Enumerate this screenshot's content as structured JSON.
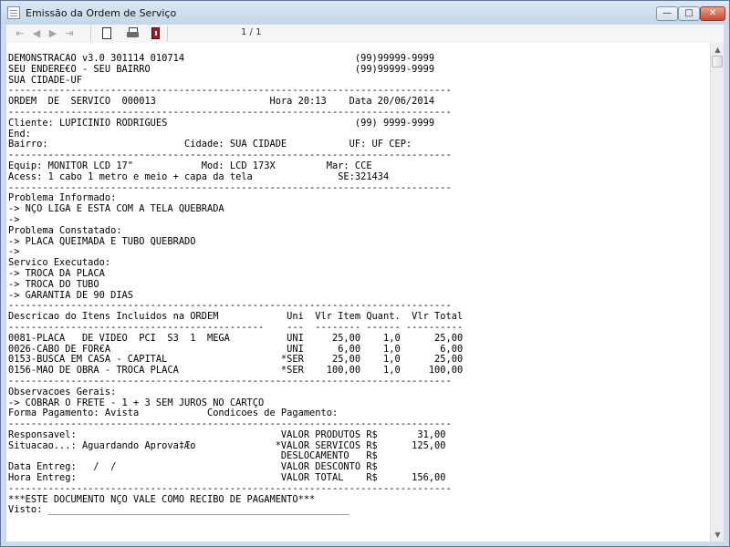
{
  "window": {
    "title": "Emissão da Ordem de Serviço",
    "controls": {
      "minimize": "—",
      "maximize": "□",
      "close": "✕"
    }
  },
  "toolbar": {
    "first_icon": "⇤",
    "prev_icon": "◀",
    "next_icon": "▶",
    "last_icon": "⇥",
    "page_indicator": "1 / 1",
    "icons": [
      "first-page-icon",
      "previous-page-icon",
      "next-page-icon",
      "last-page-icon",
      "new-document-icon",
      "printer-icon",
      "exit-icon"
    ]
  },
  "report": {
    "lines": [
      "DEMONSTRACAO v3.0 301114 010714                              (99)99999-9999",
      "SEU ENDERE€O - SEU BAIRRO                                    (99)99999-9999",
      "SUA CIDADE-UF",
      "------------------------------------------------------------------------------",
      "ORDEM  DE  SERVICO  000013                    Hora 20:13    Data 20/06/2014",
      "------------------------------------------------------------------------------",
      "Cliente: LUPICINIO RODRIGUES                                 (99) 9999-9999",
      "End:",
      "Bairro:                        Cidade: SUA CIDADE           UF: UF CEP:",
      "------------------------------------------------------------------------------",
      "Equip: MONITOR LCD 17\"            Mod: LCD 173X         Mar: CCE",
      "Acess: 1 cabo 1 metro e meio + capa da tela               SE:321434",
      "------------------------------------------------------------------------------",
      "Problema Informado:",
      "-> NÇO LIGA E ESTA COM A TELA QUEBRADA",
      "->",
      "Problema Constatado:",
      "-> PLACA QUEIMADA E TUBO QUEBRADO",
      "->",
      "Servico Executado:",
      "-> TROCA DA PLACA",
      "-> TROCA DO TUBO",
      "-> GARANTIA DE 90 DIAS",
      "------------------------------------------------------------------------------",
      "Descricao do Itens Incluidos na ORDEM            Uni  Vlr Item Quant.  Vlr Total",
      "---------------------------------------------    ---  -------- ------ ----------",
      "0081-PLACA   DE VIDEO  PCI  S3  1  MEGA          UNI     25,00    1,0      25,00",
      "0026-CABO DE FOR€A                               UNI      6,00    1,0       6,00",
      "0153-BUSCA EM CASA - CAPITAL                    *SER     25,00    1,0      25,00",
      "0156-MAO DE OBRA - TROCA PLACA                  *SER    100,00    1,0     100,00",
      "------------------------------------------------------------------------------",
      "Observacoes Gerais:",
      "-> COBRAR O FRETE - 1 + 3 SEM JUROS NO CARTÇO",
      "Forma Pagamento: Avista            Condicoes de Pagamento:",
      "------------------------------------------------------------------------------",
      "Responsavel:                                    VALOR PRODUTOS R$       31,00",
      "Situacao...: Aguardando Aprova‡Æo              *VALOR SERVICOS R$      125,00",
      "                                                DESLOCAMENTO   R$",
      "Data Entreg:   /  /                             VALOR DESCONTO R$",
      "Hora Entreg:                                    VALOR TOTAL    R$      156,00",
      "------------------------------------------------------------------------------",
      "***ESTE DOCUMENTO NÇO VALE COMO RECIBO DE PAGAMENTO***",
      "Visto: _____________________________________________________"
    ]
  },
  "scrollbar": {
    "up": "▲",
    "down": "▼"
  }
}
